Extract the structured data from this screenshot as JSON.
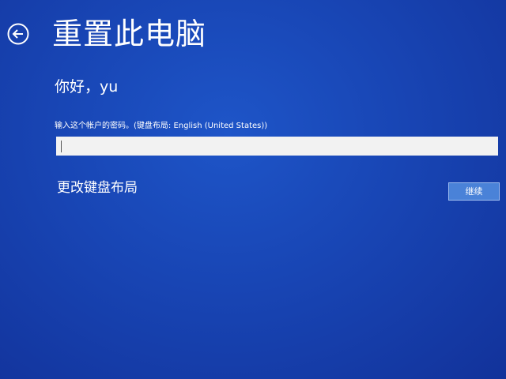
{
  "header": {
    "back_icon": "back-arrow-circle-icon",
    "title": "重置此电脑"
  },
  "account": {
    "greeting": "你好，yu"
  },
  "password": {
    "label": "输入这个帐户的密码。(键盘布局: English (United States))",
    "value": "",
    "placeholder": ""
  },
  "actions": {
    "change_keyboard_label": "更改键盘布局",
    "continue_label": "继续"
  },
  "colors": {
    "background": "#1845b4",
    "button": "#4a82d8",
    "input": "#f2f2f2",
    "text": "#ffffff"
  }
}
